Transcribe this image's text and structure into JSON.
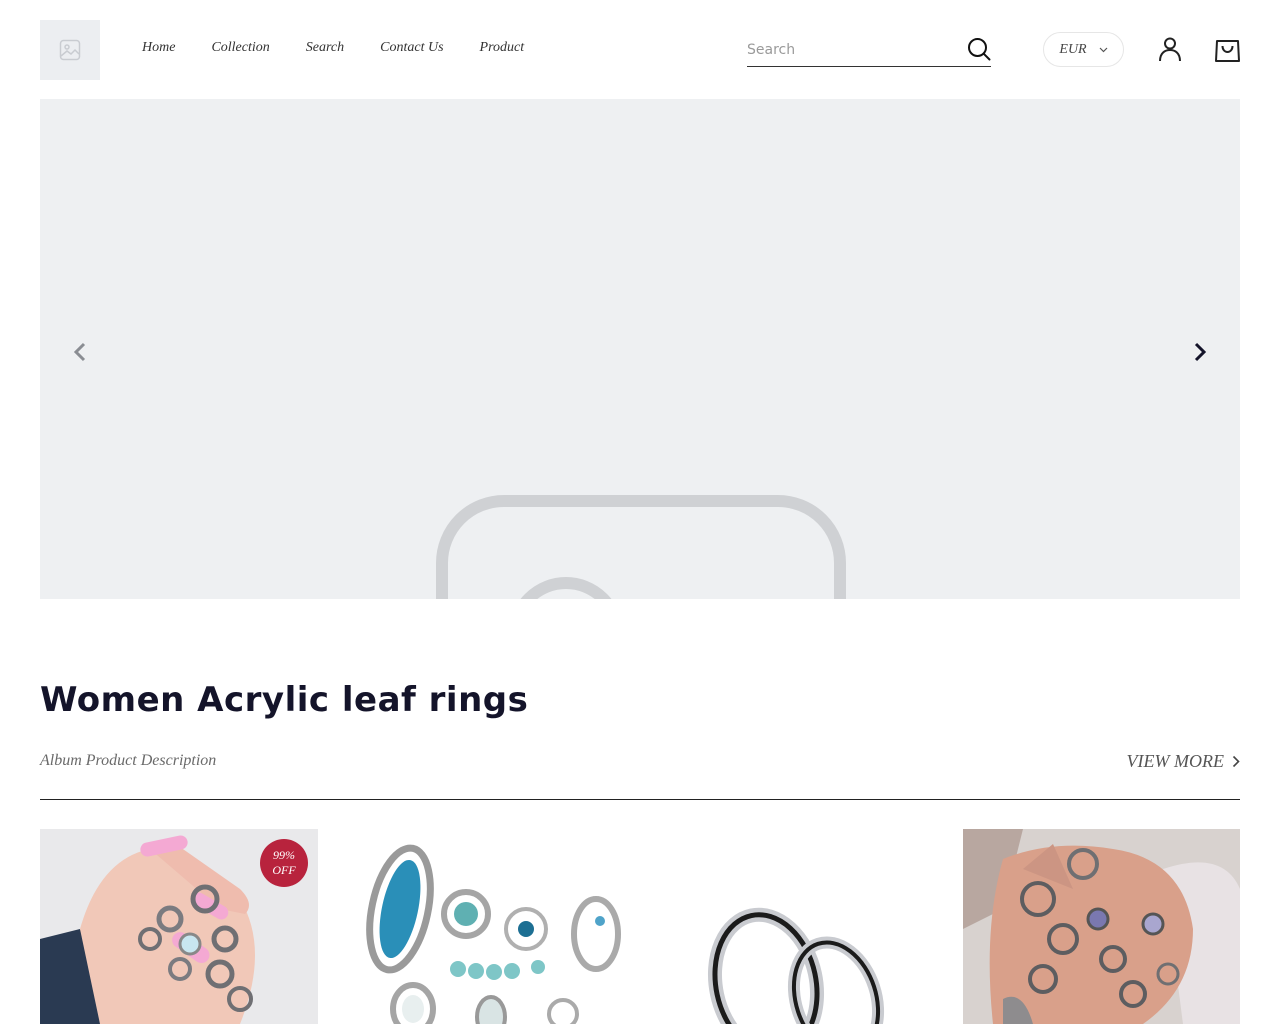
{
  "header": {
    "nav": [
      "Home",
      "Collection",
      "Search",
      "Contact Us",
      "Product"
    ],
    "search_placeholder": "Search",
    "currency": "EUR"
  },
  "banner": {
    "prev_icon": "chevron-left-icon",
    "next_icon": "chevron-right-icon"
  },
  "section": {
    "title": "Women Acrylic leaf rings",
    "description": "Album Product Description",
    "view_more": "VIEW MORE"
  },
  "products": [
    {
      "badge_line1": "99%",
      "badge_line2": "OFF",
      "image": "hand-with-silver-rings"
    },
    {
      "image": "turquoise-silver-ring-set"
    },
    {
      "image": "black-steel-couple-rings"
    },
    {
      "image": "hand-with-midi-rings"
    }
  ],
  "colors": {
    "accent": "#b8233d",
    "title": "#14142a",
    "banner_bg": "#eef0f2"
  }
}
